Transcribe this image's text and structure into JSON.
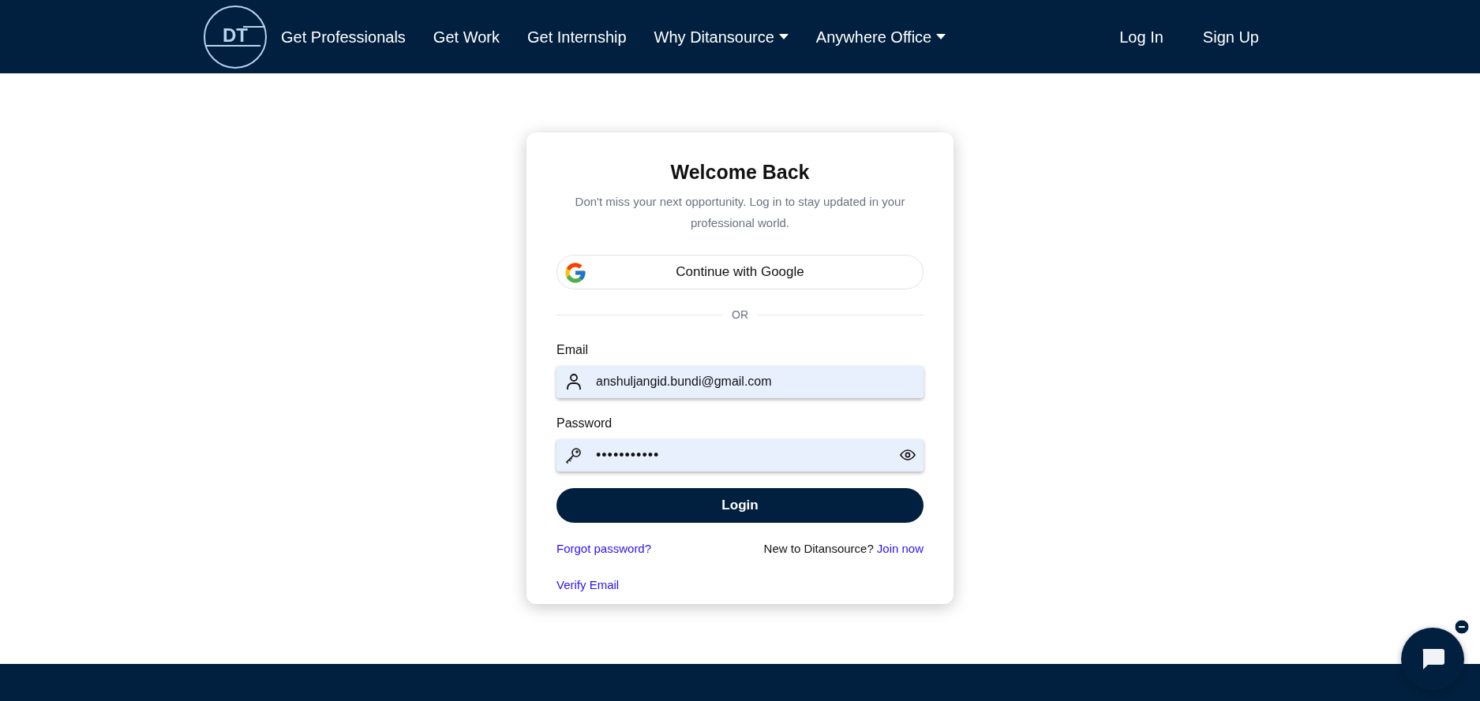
{
  "logo": {
    "text": "DT"
  },
  "nav": {
    "links": [
      {
        "label": "Get Professionals",
        "dropdown": false
      },
      {
        "label": "Get Work",
        "dropdown": false
      },
      {
        "label": "Get Internship",
        "dropdown": false
      },
      {
        "label": "Why Ditansource",
        "dropdown": true
      },
      {
        "label": "Anywhere Office",
        "dropdown": true
      }
    ],
    "auth": [
      "Log In",
      "Sign Up"
    ]
  },
  "card": {
    "title": "Welcome Back",
    "subtitle": "Don't miss your next opportunity. Log in to stay updated in your professional world.",
    "google_button": "Continue with Google",
    "divider": "OR",
    "email": {
      "label": "Email",
      "value": "anshuljangid.bundi@gmail.com"
    },
    "password": {
      "label": "Password",
      "value": "•••••••••••"
    },
    "login_button": "Login",
    "forgot_link": "Forgot password?",
    "join_text": "New to Ditansource?",
    "join_link": "Join now",
    "verify_link": "Verify Email"
  }
}
